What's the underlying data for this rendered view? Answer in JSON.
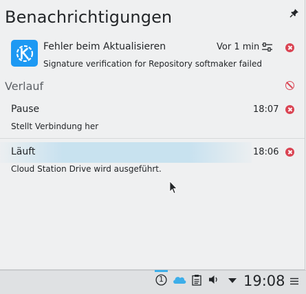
{
  "header": {
    "title": "Benachrichtigungen",
    "pin_icon": "pin-icon"
  },
  "current": {
    "app_icon": "kde-logo-icon",
    "title": "Fehler beim Aktualisieren",
    "time": "Vor 1 min",
    "body": "Signature verification for Repository softmaker failed"
  },
  "history": {
    "label": "Verlauf",
    "items": [
      {
        "title": "Pause",
        "time": "18:07",
        "body": "Stellt Verbindung her"
      },
      {
        "title": "Läuft",
        "time": "18:06",
        "body": "Cloud Station Drive wird ausgeführt."
      }
    ]
  },
  "panel": {
    "clock": "19:08",
    "update_badge": "1"
  },
  "colors": {
    "accent": "#3daee9",
    "danger": "#da4453",
    "kde_blue": "#1d99f3"
  }
}
